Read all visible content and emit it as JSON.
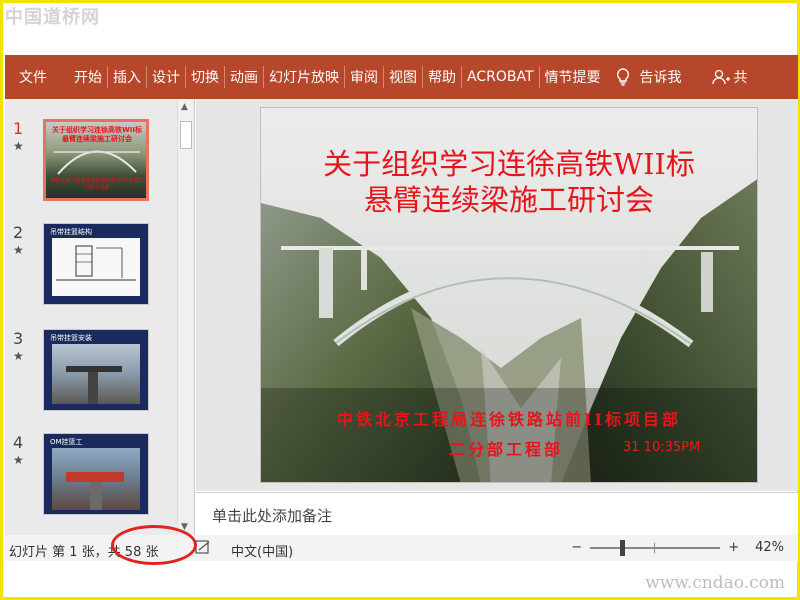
{
  "watermark_top": "中国道桥网",
  "watermark_bottom": "www.cndao.com",
  "ribbon": {
    "file": "文件",
    "tabs": [
      "开始",
      "插入",
      "设计",
      "切换",
      "动画",
      "幻灯片放映",
      "审阅",
      "视图",
      "帮助",
      "ACROBAT",
      "情节提要"
    ],
    "tell_me": "告诉我",
    "share": "共"
  },
  "thumbnails": [
    {
      "num": "1",
      "star": "★",
      "title": "关于组织学习连徐高铁WII标悬臂连续梁施工研讨会",
      "footer": "中铁北京工程局连徐铁路站前II标项目部二分部工程部"
    },
    {
      "num": "2",
      "star": "★",
      "title": "吊带挂篮结构"
    },
    {
      "num": "3",
      "star": "★",
      "title": "吊带挂篮安装"
    },
    {
      "num": "4",
      "star": "★",
      "title": "OM挂篮工"
    }
  ],
  "slide": {
    "title_line1": "关于组织学习连徐高铁WII标",
    "title_line2": "悬臂连续梁施工研讨会",
    "sub_line1": "中铁北京工程局连徐铁路站前II标项目部",
    "sub_line2": "二分部工程部",
    "time": "31  10:35PM"
  },
  "notes_placeholder": "单击此处添加备注",
  "status": {
    "slide_info": "幻灯片 第 1 张，共 58 张",
    "language": "中文(中国)",
    "zoom": "42%",
    "minus": "−",
    "plus": "+"
  },
  "colors": {
    "ribbon": "#b7472a",
    "title_red": "#e8141b",
    "highlight": "#e0241e"
  }
}
